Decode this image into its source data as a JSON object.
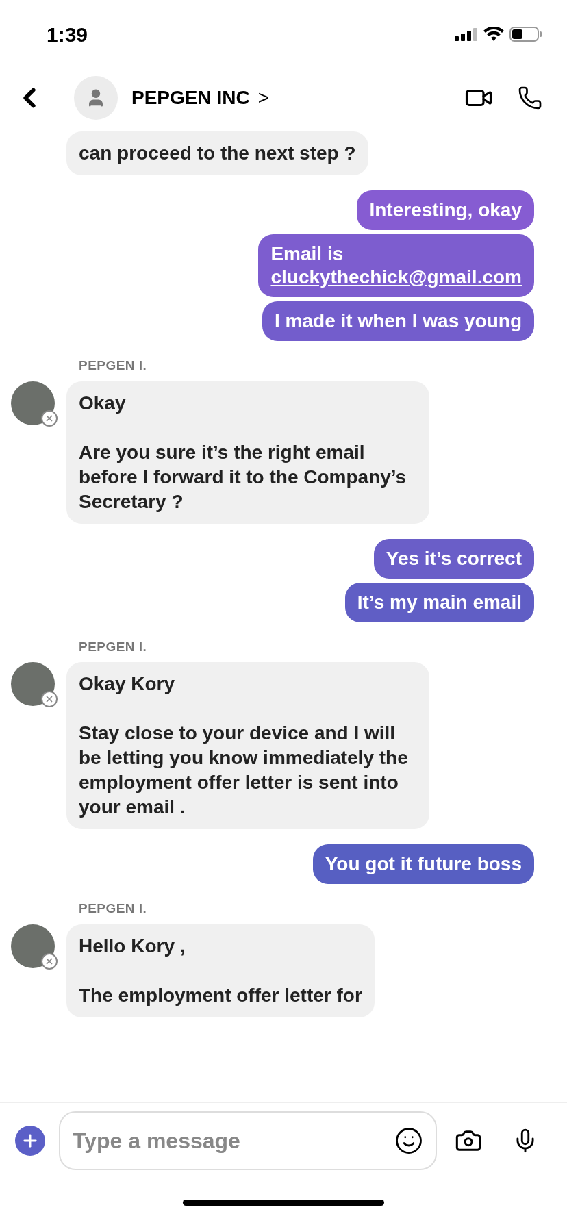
{
  "status_bar": {
    "time": "1:39"
  },
  "header": {
    "name": "PEPGEN INC",
    "chevron": ">"
  },
  "messages": [
    {
      "kind": "received",
      "text": "can proceed to the next step ?"
    },
    {
      "kind": "sent",
      "text": "Interesting, okay"
    },
    {
      "kind": "sent",
      "text": "Email is",
      "link": "cluckythechick@gmail.com"
    },
    {
      "kind": "sent",
      "text": "I made it when I was young"
    },
    {
      "kind": "received",
      "sender": "PEPGEN I.",
      "text": "Okay\n\nAre you sure it’s the right email before I forward it to the Company’s Secretary ?"
    },
    {
      "kind": "sent",
      "text": "Yes it’s correct"
    },
    {
      "kind": "sent",
      "text": "It’s my main email"
    },
    {
      "kind": "received",
      "sender": "PEPGEN I.",
      "text": "Okay Kory\n\nStay close to your device and I will be letting you know immediately the employment offer letter is sent into your email ."
    },
    {
      "kind": "sent",
      "text": "You got it future boss"
    },
    {
      "kind": "received",
      "sender": "PEPGEN I.",
      "text": "Hello Kory ,\n\nThe employment offer letter for"
    }
  ],
  "composer": {
    "placeholder": "Type a message"
  }
}
